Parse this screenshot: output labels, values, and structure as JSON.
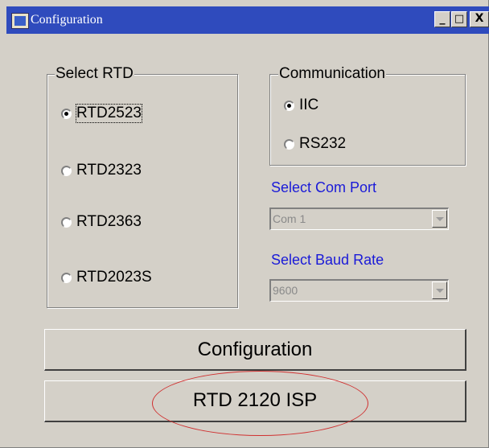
{
  "window": {
    "title": "Configuration",
    "minimize_glyph": "_",
    "maximize_glyph": "□",
    "close_glyph": "X"
  },
  "select_rtd": {
    "legend": "Select RTD",
    "options": [
      "RTD2523",
      "RTD2323",
      "RTD2363",
      "RTD2023S"
    ],
    "selected": "RTD2523"
  },
  "communication": {
    "legend": "Communication",
    "options": [
      "IIC",
      "RS232"
    ],
    "selected": "IIC"
  },
  "com_port": {
    "label": "Select Com Port",
    "value": "Com 1"
  },
  "baud_rate": {
    "label": "Select Baud Rate",
    "value": "9600"
  },
  "buttons": {
    "configuration": "Configuration",
    "isp": "RTD 2120 ISP"
  },
  "colors": {
    "title_bar": "#2f4bbd",
    "label_blue": "#1a1ad8",
    "annotation_red": "#d03030"
  }
}
